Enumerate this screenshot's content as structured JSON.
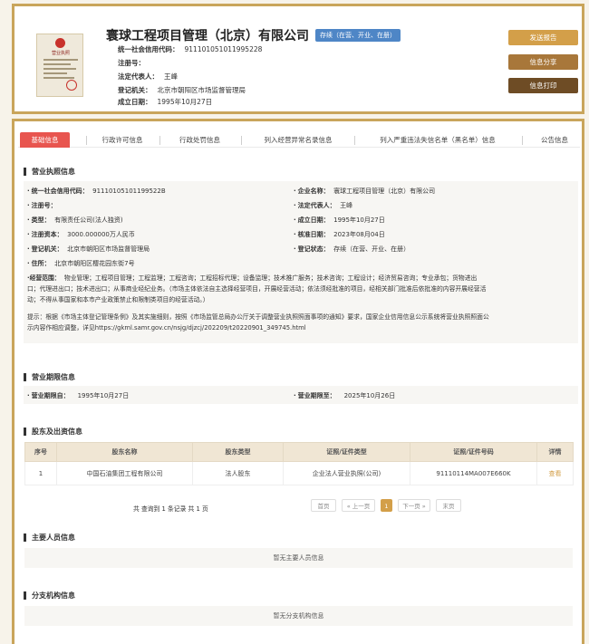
{
  "header": {
    "license_title": "营业执照",
    "company_name": "寰球工程项目管理（北京）有限公司",
    "status": "存续（在营、开业、在册）",
    "fields": [
      {
        "label": "统一社会信用代码：",
        "value": "911101051011995228"
      },
      {
        "label": "注册号：",
        "value": ""
      },
      {
        "label": "法定代表人：",
        "value": "王峰"
      },
      {
        "label": "登记机关：",
        "value": "北京市朝阳区市场监督管理局"
      },
      {
        "label": "成立日期：",
        "value": "1995年10月27日"
      }
    ],
    "buttons": {
      "report": "发送报告",
      "share": "信息分享",
      "print": "信息打印"
    }
  },
  "tabs": [
    "基础信息",
    "行政许可信息",
    "行政处罚信息",
    "列入经营异常名录信息",
    "列入严重违法失信名单（黑名单）信息",
    "公告信息"
  ],
  "license_section": {
    "title": "营业执照信息",
    "left": [
      {
        "label": "统一社会信用代码：",
        "value": "91110105101199522B"
      },
      {
        "label": "注册号：",
        "value": ""
      },
      {
        "label": "类型：",
        "value": "有限责任公司(法人独资)"
      },
      {
        "label": "注册资本：",
        "value": "3000.000000万人民币"
      },
      {
        "label": "登记机关：",
        "value": "北京市朝阳区市场监督管理局"
      },
      {
        "label": "住所：",
        "value": "北京市朝阳区樱花园东街7号"
      }
    ],
    "right": [
      {
        "label": "企业名称：",
        "value": "寰球工程项目管理（北京）有限公司"
      },
      {
        "label": "法定代表人：",
        "value": "王峰"
      },
      {
        "label": "成立日期：",
        "value": "1995年10月27日"
      },
      {
        "label": "核准日期：",
        "value": "2023年08月04日"
      },
      {
        "label": "登记状态：",
        "value": "存续（在营、开业、在册）"
      }
    ],
    "scope_label": "经营范围：",
    "scope_lines": [
      "物业管理；工程项目管理；工程监理；工程咨询；工程招标代理；设备监理；技术推广服务；技术咨询；工程设计；经济贸易咨询；专业承包；货物进出",
      "口；代理进出口；技术进出口；从事商业经纪业务。（市场主体依法自主选择经营项目，开展经营活动；依法须经批准的项目，经相关部门批准后依批准的内容开展经营活",
      "动；不得从事国家和本市产业政策禁止和限制类项目的经营活动。）"
    ],
    "tip_lines": [
      "提示：根据《市场主体登记管理条例》及其实施细则，按照《市场监管总局办公厅关于调整营业执照照面事项的通知》要求，国家企业信用信息公示系统将营业执照照面公",
      "示内容作相应调整，详见https://gkml.samr.gov.cn/nsjg/djzcj/202209/t20220901_349745.html"
    ]
  },
  "period_section": {
    "title": "营业期限信息",
    "from_label": "营业期限自：",
    "from_value": "1995年10月27日",
    "to_label": "营业期限至：",
    "to_value": "2025年10月26日"
  },
  "shareholder_section": {
    "title": "股东及出资信息",
    "headers": [
      "序号",
      "股东名称",
      "股东类型",
      "证照/证件类型",
      "证照/证件号码",
      "详情"
    ],
    "rows": [
      {
        "no": "1",
        "name": "中国石油集团工程有限公司",
        "type": "法人股东",
        "cert_type": "企业法人营业执照(公司)",
        "cert_no": "91110114MA007E660K",
        "detail": "查看"
      }
    ],
    "pager_info": "共 查询到 1 条记录 共 1 页",
    "pager": {
      "first": "首页",
      "prev": "« 上一页",
      "current": "1",
      "next": "下一页 »",
      "last": "末页"
    }
  },
  "personnel_section": {
    "title": "主要人员信息",
    "empty": "暂无主要人员信息"
  },
  "branch_section": {
    "title": "分支机构信息",
    "empty": "暂无分支机构信息"
  }
}
